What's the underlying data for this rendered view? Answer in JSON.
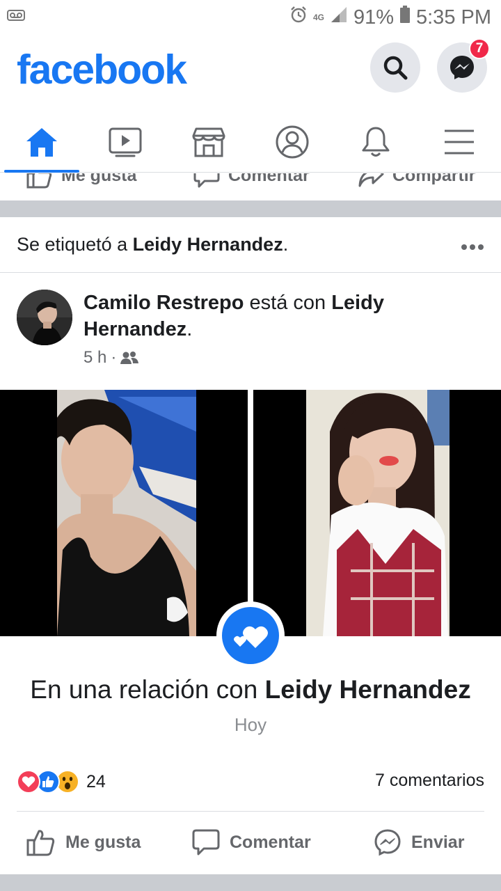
{
  "status_bar": {
    "network": "4G",
    "battery": "91%",
    "time": "5:35 PM"
  },
  "header": {
    "logo": "facebook",
    "messenger_badge": "7"
  },
  "tabs": [
    {
      "name": "home",
      "active": true
    },
    {
      "name": "watch",
      "active": false
    },
    {
      "name": "marketplace",
      "active": false
    },
    {
      "name": "profile",
      "active": false
    },
    {
      "name": "notifications",
      "active": false
    },
    {
      "name": "menu",
      "active": false
    }
  ],
  "previous_post": {
    "like_label": "Me gusta",
    "comment_label": "Comentar",
    "share_label": "Compartir"
  },
  "post": {
    "tag_prefix": "Se etiquetó a ",
    "tag_name": "Leidy Hernandez",
    "tag_suffix": ".",
    "author": "Camilo Restrepo",
    "with_text": " está con ",
    "with_name": "Leidy Hernandez",
    "with_suffix": ".",
    "time": "5 h",
    "privacy_icon": "friends-icon",
    "relationship_prefix": "En una relación con ",
    "relationship_name": "Leidy Hernandez",
    "relationship_date": "Hoy",
    "reaction_count": "24",
    "comments": "7 comentarios",
    "actions": {
      "like": "Me gusta",
      "comment": "Comentar",
      "send": "Enviar"
    }
  },
  "colors": {
    "brand": "#1877f2",
    "badge": "#f02849",
    "love": "#f33e58",
    "wow": "#f7b125"
  }
}
